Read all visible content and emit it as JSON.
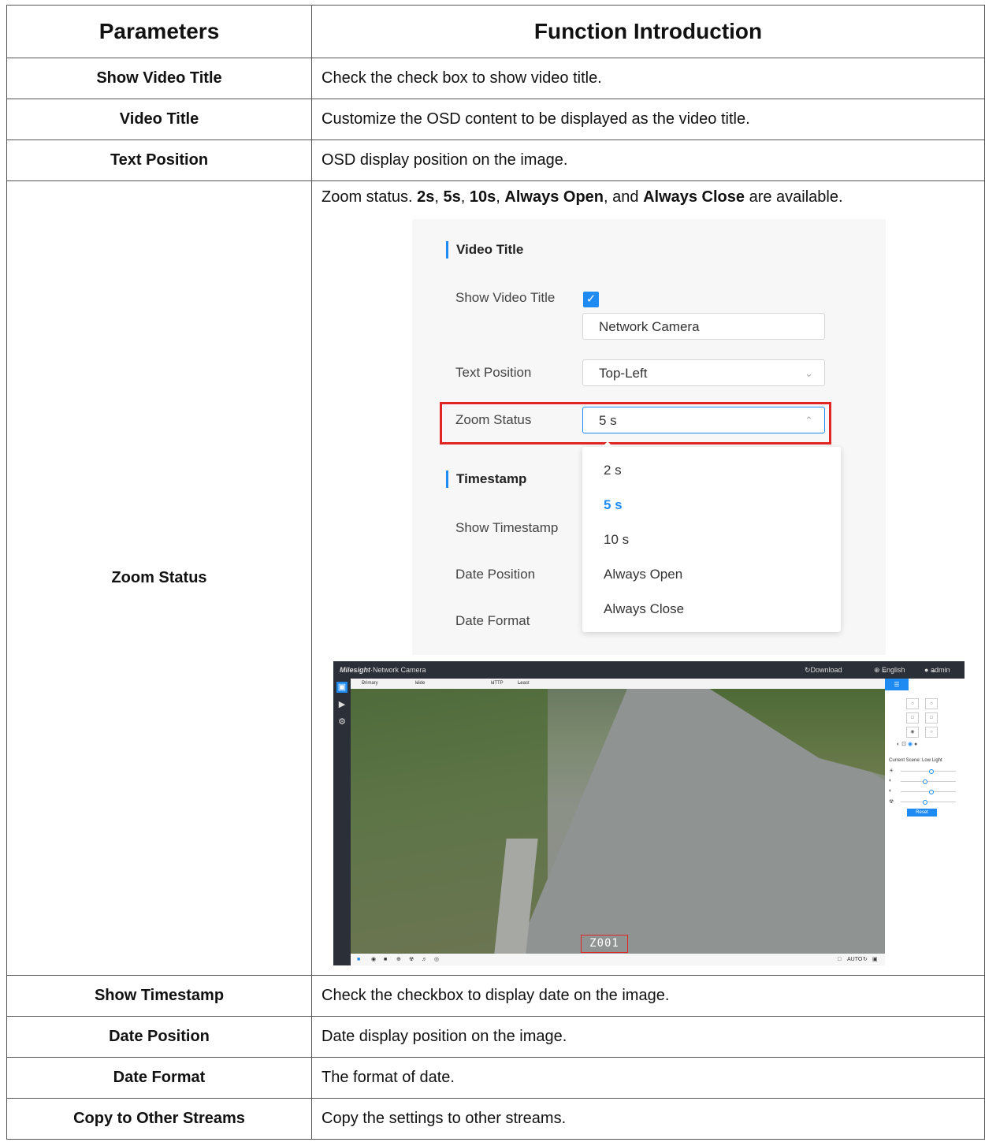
{
  "table": {
    "headers": [
      "Parameters",
      "Function Introduction"
    ],
    "rows": [
      {
        "param": "Show Video Title",
        "desc": "Check the check box to show video title."
      },
      {
        "param": "Video Title",
        "desc": "Customize the OSD content to be displayed as the video title."
      },
      {
        "param": "Text Position",
        "desc": "OSD display position on the image."
      },
      {
        "param": "Zoom Status",
        "desc_parts": [
          "Zoom status. ",
          "2s",
          ", ",
          "5s",
          ", ",
          "10s",
          ", ",
          "Always Open",
          ", and ",
          "Always Close",
          " are available."
        ]
      },
      {
        "param": "Show Timestamp",
        "desc": "Check the checkbox to display date on the image."
      },
      {
        "param": "Date Position",
        "desc": "Date display position on the image."
      },
      {
        "param": "Date Format",
        "desc": "The format of date."
      },
      {
        "param": "Copy to Other Streams",
        "desc": "Copy the settings to other streams."
      }
    ]
  },
  "settings_screenshot": {
    "section_video_title": "Video Title",
    "show_video_title_label": "Show Video Title",
    "checkbox_mark": "✓",
    "video_title_value": "Network Camera",
    "text_position_label": "Text Position",
    "text_position_value": "Top-Left",
    "zoom_status_label": "Zoom Status",
    "zoom_status_value": "5 s",
    "section_timestamp": "Timestamp",
    "show_timestamp_label": "Show Timestamp",
    "date_position_label": "Date Position",
    "date_format_label": "Date Format",
    "dropdown_options": [
      "2 s",
      "5 s",
      "10 s",
      "Always Open",
      "Always Close"
    ],
    "selected_option": "5 s"
  },
  "camera_screenshot": {
    "brand": "Milesight",
    "app_title": "·Network Camera",
    "download_plugin": "Download Plug-in",
    "language": "English",
    "user": "admin",
    "toolbar": [
      "Primary Stream",
      "Hide Detection Region",
      "HTTP",
      "Least Delay"
    ],
    "zoom_label": "Z001",
    "auto_label": "AUTO",
    "scene_label": "Current Scene: Low Light",
    "reset_label": "Reset",
    "colors": {
      "accent": "#1e8bf2",
      "highlight": "#e12525",
      "topbar": "#2b2f38"
    }
  }
}
